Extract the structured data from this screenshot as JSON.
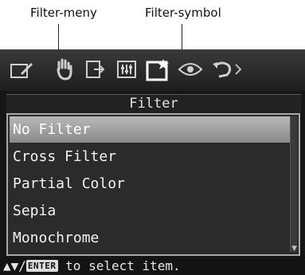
{
  "callouts": {
    "filter_menu": "Filter-meny",
    "filter_symbol": "Filter-symbol"
  },
  "toolbar": {
    "tools": [
      "edit-icon",
      "hand-icon",
      "adjust-icon",
      "sliders-icon",
      "filter-icon",
      "eye-icon",
      "rotate-icon"
    ],
    "selected": "filter-icon"
  },
  "menu": {
    "title": "Filter",
    "items": [
      "No Filter",
      "Cross Filter",
      "Partial Color",
      "Sepia",
      "Monochrome"
    ],
    "selected_index": 0
  },
  "hint": {
    "arrows": "▲▼/",
    "key": "ENTER",
    "text": " to select item."
  },
  "colors": {
    "screen_bg": "#161616",
    "selection": "#a0a0a0"
  }
}
